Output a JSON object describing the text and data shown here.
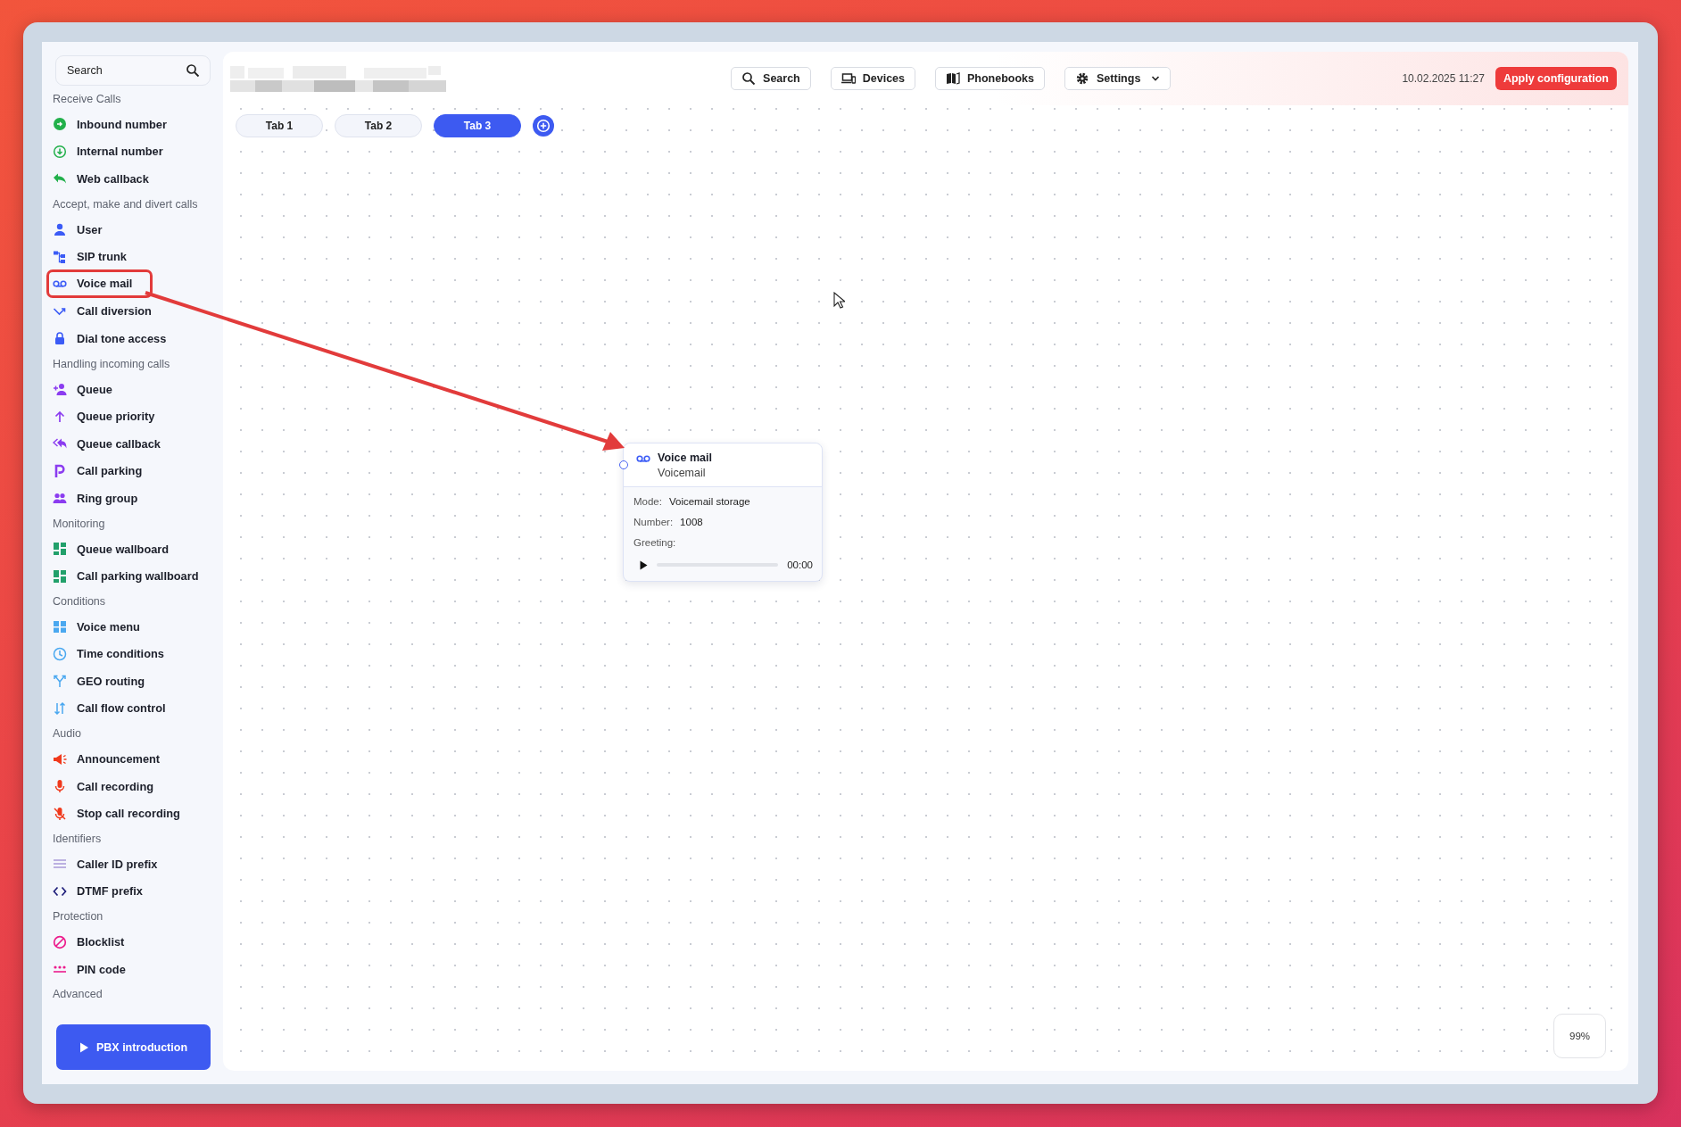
{
  "sidebar": {
    "search": {
      "placeholder": "Search"
    },
    "groups": [
      {
        "title": "Receive Calls",
        "items": [
          {
            "label": "Inbound number",
            "highlighted": false
          },
          {
            "label": "Internal number",
            "highlighted": false
          },
          {
            "label": "Web callback",
            "highlighted": false
          }
        ]
      },
      {
        "title": "Accept, make and divert calls",
        "items": [
          {
            "label": "User",
            "highlighted": false
          },
          {
            "label": "SIP trunk",
            "highlighted": false
          },
          {
            "label": "Voice mail",
            "highlighted": true
          },
          {
            "label": "Call diversion",
            "highlighted": false
          },
          {
            "label": "Dial tone access",
            "highlighted": false
          }
        ]
      },
      {
        "title": "Handling incoming calls",
        "items": [
          {
            "label": "Queue",
            "highlighted": false
          },
          {
            "label": "Queue priority",
            "highlighted": false
          },
          {
            "label": "Queue callback",
            "highlighted": false
          },
          {
            "label": "Call parking",
            "highlighted": false
          },
          {
            "label": "Ring group",
            "highlighted": false
          }
        ]
      },
      {
        "title": "Monitoring",
        "items": [
          {
            "label": "Queue wallboard",
            "highlighted": false
          },
          {
            "label": "Call parking wallboard",
            "highlighted": false
          }
        ]
      },
      {
        "title": "Conditions",
        "items": [
          {
            "label": "Voice menu",
            "highlighted": false
          },
          {
            "label": "Time conditions",
            "highlighted": false
          },
          {
            "label": "GEO routing",
            "highlighted": false
          },
          {
            "label": "Call flow control",
            "highlighted": false
          }
        ]
      },
      {
        "title": "Audio",
        "items": [
          {
            "label": "Announcement",
            "highlighted": false
          },
          {
            "label": "Call recording",
            "highlighted": false
          },
          {
            "label": "Stop call recording",
            "highlighted": false
          }
        ]
      },
      {
        "title": "Identifiers",
        "items": [
          {
            "label": "Caller ID prefix",
            "highlighted": false
          },
          {
            "label": "DTMF prefix",
            "highlighted": false
          }
        ]
      },
      {
        "title": "Protection",
        "items": [
          {
            "label": "Blocklist",
            "highlighted": false
          },
          {
            "label": "PIN code",
            "highlighted": false
          }
        ]
      },
      {
        "title": "Advanced"
      }
    ],
    "intro_button": "PBX introduction"
  },
  "toolbar": {
    "buttons": [
      {
        "label": "Search",
        "dropdown": false
      },
      {
        "label": "Devices",
        "dropdown": false
      },
      {
        "label": "Phonebooks",
        "dropdown": false
      },
      {
        "label": "Settings",
        "dropdown": true
      }
    ],
    "datetime": "10.02.2025 11:27",
    "apply_button": "Apply configuration"
  },
  "tabs": [
    {
      "label": "Tab 1",
      "selected": false
    },
    {
      "label": "Tab 2",
      "selected": false
    },
    {
      "label": "Tab 3",
      "selected": true
    }
  ],
  "canvas": {
    "node": {
      "title": "Voice mail",
      "subtitle": "Voicemail",
      "fields": [
        {
          "label": "Mode:",
          "value": "Voicemail storage"
        },
        {
          "label": "Number:",
          "value": "1008"
        }
      ],
      "greeting_label": "Greeting:",
      "player": {
        "level": 0,
        "time": "00:00"
      }
    },
    "zoom": "99%"
  },
  "annotation": {
    "kind": "arrow"
  }
}
